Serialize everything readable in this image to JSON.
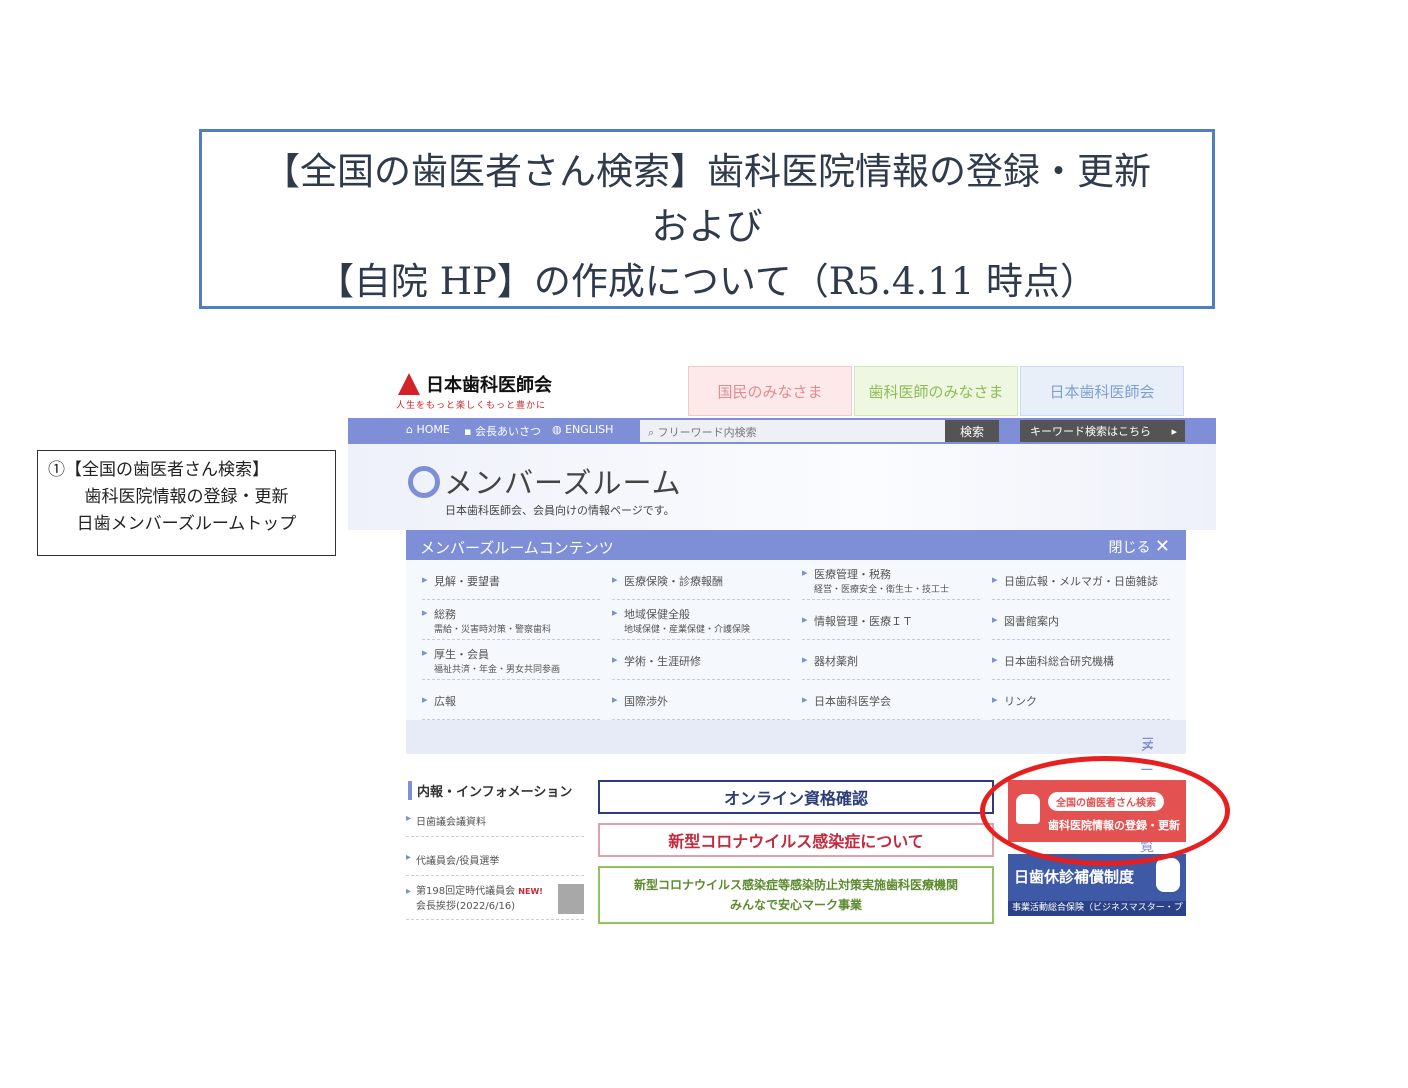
{
  "slide": {
    "title_lines": [
      "【全国の歯医者さん検索】歯科医院情報の登録・更新",
      "および",
      "【自院 HP】の作成について（R5.4.11 時点）"
    ],
    "note_lines": [
      "①【全国の歯医者さん検索】",
      "歯科医院情報の登録・更新",
      "日歯メンバーズルームトップ"
    ]
  },
  "site": {
    "logo": {
      "name": "日本歯科医師会",
      "tagline": "人生をもっと楽しくもっと豊かに"
    },
    "header_tabs": [
      "国民のみなさま",
      "歯科医師のみなさま",
      "日本歯科医師会"
    ],
    "nav": {
      "home": "HOME",
      "greeting": "会長あいさつ",
      "english": "ENGLISH",
      "search_placeholder": "フリーワード内検索",
      "search_button": "検索",
      "keyword_button": "キーワード検索はこちら"
    },
    "room": {
      "title": "メンバーズルーム",
      "subtitle": "日本歯科医師会、会員向けの情報ページです。"
    },
    "panel": {
      "title": "メンバーズルームコンテンツ",
      "close": "閉じる",
      "menu_all": "メニュー一覧",
      "items": [
        {
          "label": "見解・要望書",
          "sub": ""
        },
        {
          "label": "医療保険・診療報酬",
          "sub": ""
        },
        {
          "label": "医療管理・税務",
          "sub": "経営・医療安全・衛生士・技工士"
        },
        {
          "label": "日歯広報・メルマガ・日歯雑誌",
          "sub": ""
        },
        {
          "label": "総務",
          "sub": "需給・災害時対策・警察歯科"
        },
        {
          "label": "地域保健全般",
          "sub": "地域保健・産業保健・介護保険"
        },
        {
          "label": "情報管理・医療ＩＴ",
          "sub": ""
        },
        {
          "label": "図書館案内",
          "sub": ""
        },
        {
          "label": "厚生・会員",
          "sub": "福祉共済・年金・男女共同参画"
        },
        {
          "label": "学術・生涯研修",
          "sub": ""
        },
        {
          "label": "器材薬剤",
          "sub": ""
        },
        {
          "label": "日本歯科総合研究機構",
          "sub": ""
        },
        {
          "label": "広報",
          "sub": ""
        },
        {
          "label": "国際渉外",
          "sub": ""
        },
        {
          "label": "日本歯科医学会",
          "sub": ""
        },
        {
          "label": "リンク",
          "sub": ""
        }
      ]
    },
    "info": {
      "title": "内報・インフォメーション",
      "items": [
        "日歯議会議資料",
        "代議員会/役員選挙",
        "第198回定時代議員会",
        "会長挨拶(2022/6/16)"
      ],
      "new_badge": "NEW!"
    },
    "banners": {
      "online": "オンライン資格確認",
      "corona": "新型コロナウイルス感染症について",
      "safe_line1": "新型コロナウイルス感染症等感染防止対策実施歯科医療機関",
      "safe_line2": "みんなで安心マーク事業",
      "search_line1": "全国の歯医者さん検索",
      "search_line2": "歯科医院情報の登録・更新",
      "insurance_line1": "日歯休診補償制度",
      "insurance_line2": "事業活動総合保険（ビジネスマスター・プラス）"
    },
    "colors": {
      "nav": "#7e8fd8",
      "highlight": "#e81f1f",
      "brand_red": "#d2232a"
    }
  }
}
